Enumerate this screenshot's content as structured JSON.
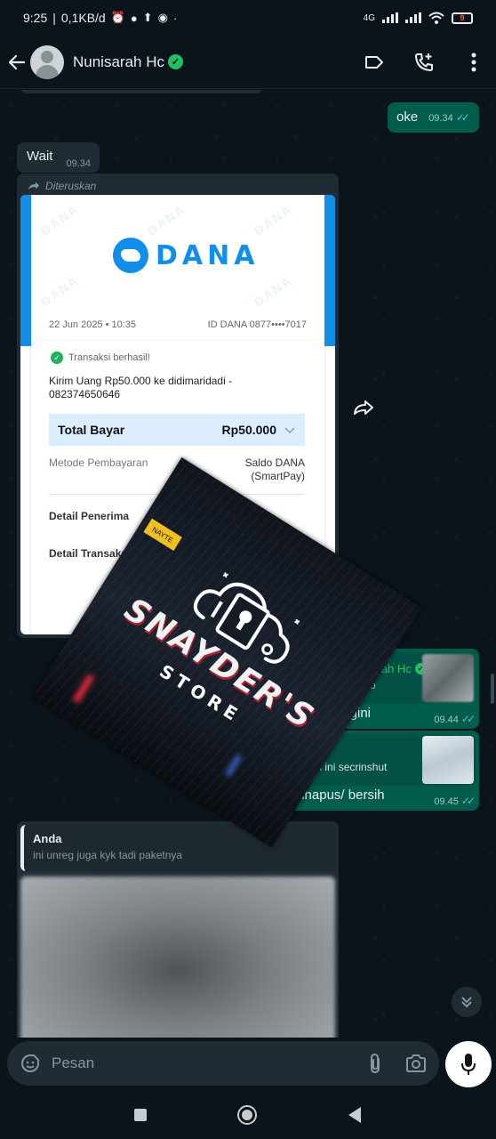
{
  "status_bar": {
    "time": "9:25",
    "speed": "0,1KB/d",
    "network_label": "4G",
    "battery": "9"
  },
  "header": {
    "contact_name": "Nunisarah Hc",
    "verified": true,
    "icons": [
      "back-arrow-icon",
      "label-icon",
      "add-call-icon",
      "more-vert-icon"
    ]
  },
  "messages": {
    "oke": {
      "text": "oke",
      "time": "09.34",
      "status": "read"
    },
    "wait": {
      "text": "Wait",
      "time": "09.34"
    },
    "forwarded": {
      "label": "Diteruskan",
      "receipt": {
        "brand": "DANA",
        "date": "22 Jun 2025 • 10:35",
        "id": "ID DANA 0877••••7017",
        "status": "Transaksi berhasil!",
        "title": "Kirim Uang Rp50.000 ke didimaridadi - 082374650646",
        "total_label": "Total Bayar",
        "total_amount": "Rp50.000",
        "method_label": "Metode Pembayaran",
        "method_value_1": "Saldo DANA",
        "method_value_2": "(SmartPay)",
        "detail_1": "Detail Penerima",
        "detail_2": "Detail Transaksi",
        "watermark": "DANA"
      }
    },
    "reply1": {
      "quote_name": "Nunisarah Hc",
      "quote_type": "Foto",
      "text": "kyk gini",
      "time": "09.44",
      "status": "read"
    },
    "reply2": {
      "quote_text": "ian ini secrinshut",
      "text": "klo udah dihapus/ bersih",
      "time": "09.45",
      "status": "read"
    },
    "anda": {
      "quote_name": "Anda",
      "quote_text": "ini unreg juga kyk tadi paketnya"
    }
  },
  "overlay": {
    "title": "SNAYDER'S",
    "subtitle": "STORE",
    "neon_sign": "NAYTE"
  },
  "input": {
    "placeholder": "Pesan"
  },
  "colors": {
    "background": "#0b141a",
    "outgoing_bubble": "#005c4b",
    "incoming_bubble": "#202c33",
    "accent_green": "#21c063",
    "read_ticks": "#53bdeb",
    "dana_blue": "#118eea"
  }
}
